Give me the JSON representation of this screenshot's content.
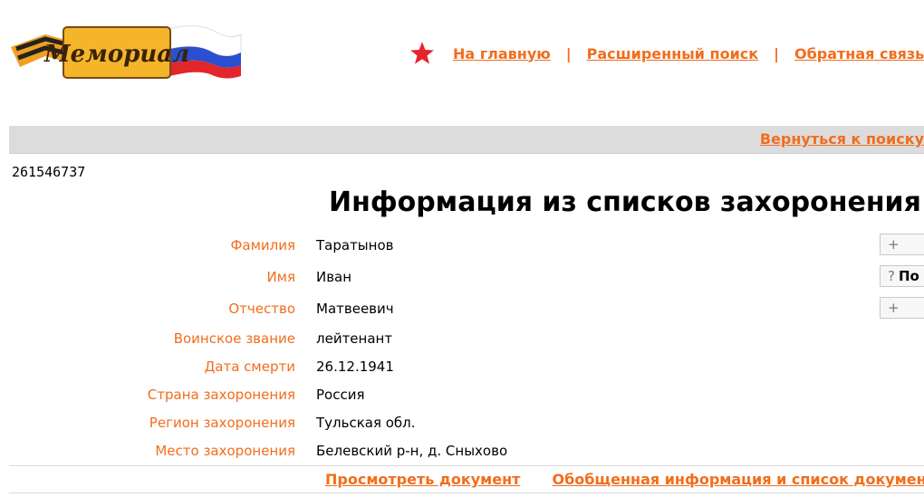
{
  "logo": {
    "text": "Мемориал"
  },
  "nav": {
    "home": "На главную",
    "advanced_search": "Расширенный поиск",
    "feedback": "Обратная связь",
    "separator": "|"
  },
  "back_to_search": "Вернуться к поиску",
  "record_id": "261546737",
  "page_title": "Информация из списков захоронения",
  "fields": [
    {
      "label": "Фамилия",
      "value": "Таратынов"
    },
    {
      "label": "Имя",
      "value": "Иван"
    },
    {
      "label": "Отчество",
      "value": "Матвеевич"
    },
    {
      "label": "Воинское звание",
      "value": "лейтенант"
    },
    {
      "label": "Дата смерти",
      "value": "26.12.1941"
    },
    {
      "label": "Страна захоронения",
      "value": "Россия"
    },
    {
      "label": "Регион захоронения",
      "value": "Тульская обл."
    },
    {
      "label": "Место захоронения",
      "value": "Белевский р-н, д. Сныхово"
    }
  ],
  "side_buttons": {
    "b1": "+",
    "b2_sym": "?",
    "b2_text": "По",
    "b3": "+"
  },
  "doc_links": {
    "view_document": "Просмотреть документ",
    "summary": "Обобщенная информация и список документов"
  },
  "colors": {
    "link": "#f26d1d",
    "bar": "#dcdcdc",
    "star": "#e8242b"
  }
}
